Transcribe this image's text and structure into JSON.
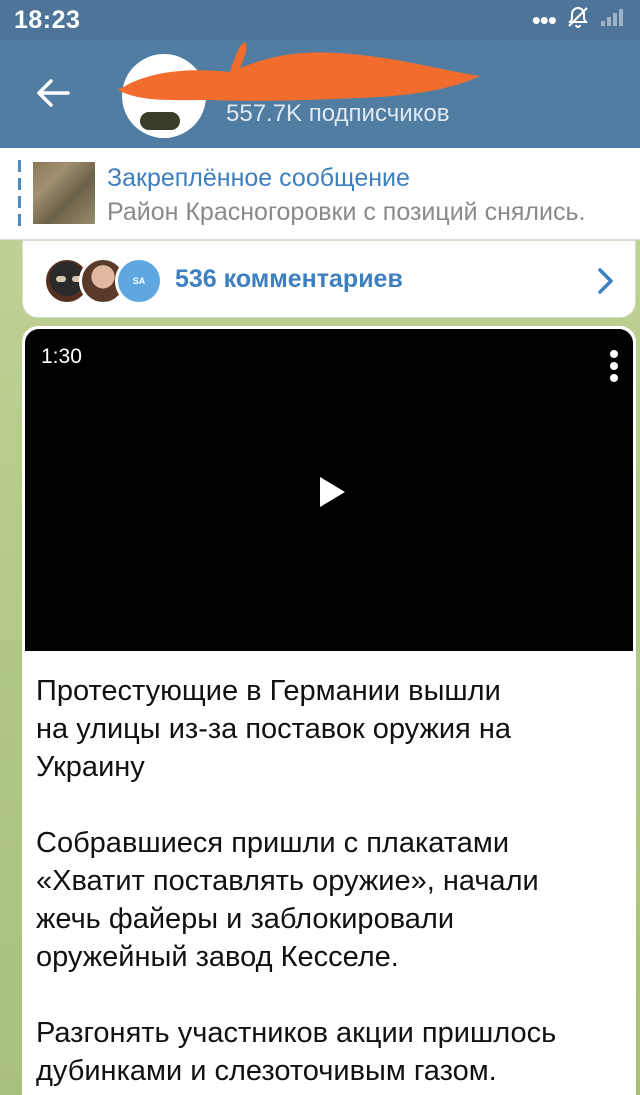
{
  "status_bar": {
    "time": "18:23",
    "icons": [
      "more-dots-icon",
      "alarm-off-icon",
      "signal-icon"
    ]
  },
  "header": {
    "back_icon": "arrow-left-icon",
    "subscribers": "557.7K подписчиков",
    "colors": {
      "bar": "#517da2"
    }
  },
  "pinned": {
    "title": "Закреплённое сообщение",
    "text": "Район Красногоровки с позиций снялись."
  },
  "comments": {
    "label": "536 комментариев",
    "avatar_initials": "SA",
    "chevron_icon": "chevron-right-icon"
  },
  "video": {
    "duration": "1:30",
    "menu_icon": "more-vertical-icon",
    "play_icon": "play-icon"
  },
  "post": {
    "paragraphs": [
      [
        "Протестующие в Германии вышли",
        "на улицы из-за поставок оружия на",
        "Украину"
      ],
      [
        "Собравшиеся пришли с плакатами",
        "«Хватит поставлять оружие», начали",
        "жечь файеры и заблокировали",
        "оружейный завод Кесселе."
      ],
      [
        "Разгонять участников акции пришлось",
        "дубинками и слезоточивым газом."
      ]
    ]
  },
  "colors": {
    "accent": "#3d7fbf",
    "header": "#517da2",
    "status_bar": "#4f7499"
  }
}
